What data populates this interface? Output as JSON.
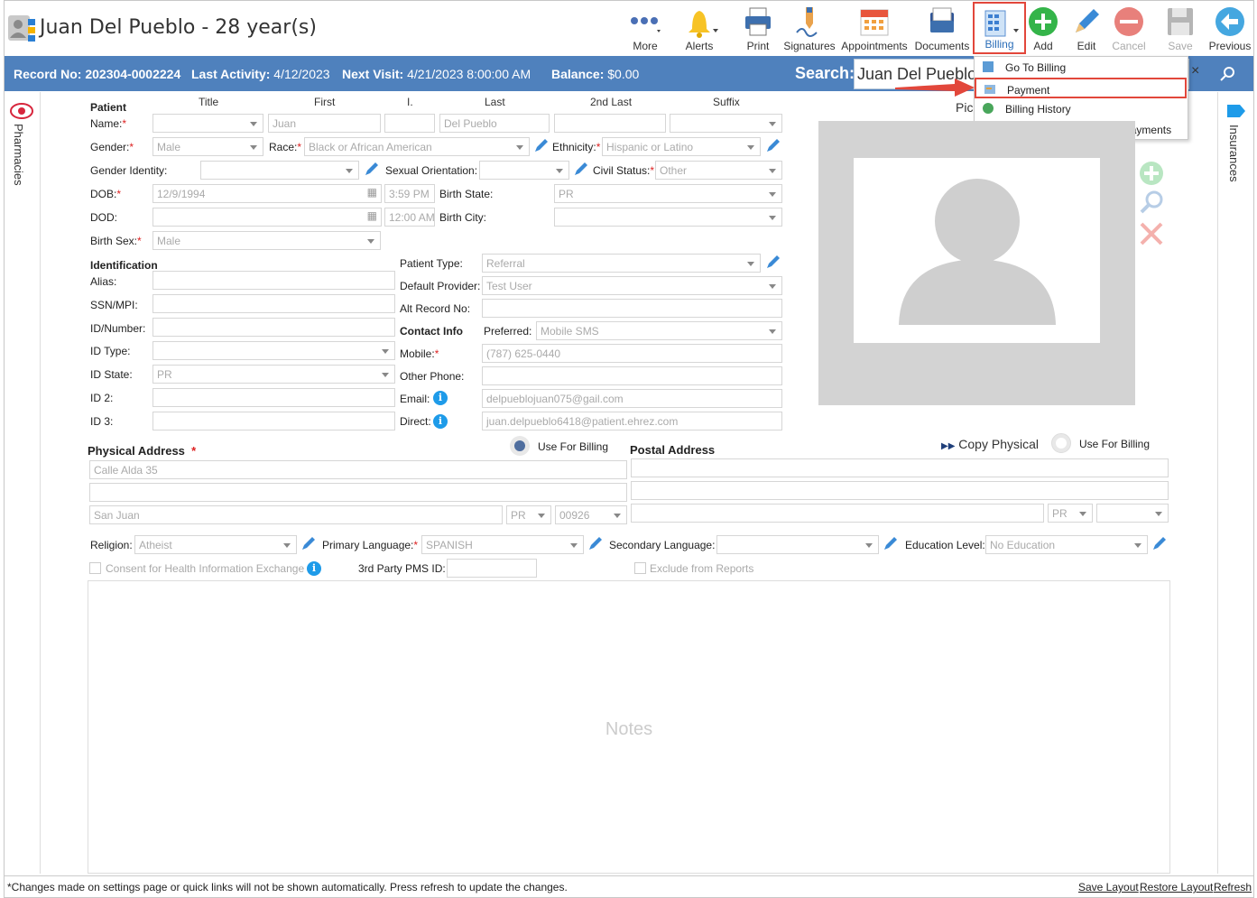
{
  "header": {
    "patient_title": "Juan Del Pueblo - 28 year(s)"
  },
  "toolbar": {
    "more": "More",
    "alerts": "Alerts",
    "print": "Print",
    "signatures": "Signatures",
    "appointments": "Appointments",
    "documents": "Documents",
    "billing": "Billing",
    "add": "Add",
    "edit": "Edit",
    "cancel": "Cancel",
    "save": "Save",
    "previous": "Previous"
  },
  "infobar": {
    "record_label": "Record No:",
    "record_value": "202304-0002224",
    "activity_label": "Last Activity:",
    "activity_value": "4/12/2023",
    "visit_label": "Next Visit:",
    "visit_value": "4/21/2023 8:00:00 AM",
    "balance_label": "Balance:",
    "balance_value": "$0.00",
    "search_label": "Search:",
    "search_value": "Juan Del Pueblo"
  },
  "billing_menu": [
    "Go To Billing",
    "Payment",
    "Billing History",
    "Daily Report - Purchase Payments"
  ],
  "side": {
    "left": "Pharmacies",
    "right": "Insurances"
  },
  "cols": {
    "title": "Title",
    "first": "First",
    "initial": "I.",
    "last": "Last",
    "second_last": "2nd Last",
    "suffix": "Suffix"
  },
  "labels": {
    "patient": "Patient",
    "name": "Name:",
    "gender": "Gender:",
    "race": "Race:",
    "ethnicity": "Ethnicity:",
    "gender_identity": "Gender Identity:",
    "sexual_orientation": "Sexual Orientation:",
    "civil_status": "Civil Status:",
    "dob": "DOB:",
    "birth_state": "Birth State:",
    "dod": "DOD:",
    "birth_city": "Birth City:",
    "birth_sex": "Birth Sex:",
    "identification": "Identification",
    "alias": "Alias:",
    "ssn": "SSN/MPI:",
    "id_number": "ID/Number:",
    "id_type": "ID Type:",
    "id_state": "ID State:",
    "id2": "ID 2:",
    "id3": "ID 3:",
    "patient_type": "Patient Type:",
    "default_provider": "Default Provider:",
    "alt_record": "Alt Record No:",
    "contact_info": "Contact Info",
    "preferred": "Preferred:",
    "mobile": "Mobile:",
    "other_phone": "Other Phone:",
    "email": "Email:",
    "direct": "Direct:",
    "physical_address": "Physical Address",
    "use_for_billing": "Use For Billing",
    "postal_address": "Postal Address",
    "copy_physical": "Copy Physical",
    "religion": "Religion:",
    "primary_language": "Primary Language:",
    "secondary_language": "Secondary Language:",
    "education_level": "Education Level:",
    "consent": "Consent for Health Information Exchange",
    "pms_id": "3rd Party PMS ID:",
    "exclude": "Exclude from Reports",
    "notes": "Notes",
    "picture": "Pic"
  },
  "values": {
    "first": "Juan",
    "last": "Del Pueblo",
    "gender": "Male",
    "race": "Black or African American",
    "ethnicity": "Hispanic or Latino",
    "civil_status": "Other",
    "dob": "12/9/1994",
    "dob_time": "3:59 PM",
    "birth_state": "PR",
    "dod_time": "12:00 AM",
    "birth_sex": "Male",
    "id_state": "PR",
    "patient_type": "Referral",
    "default_provider": "Test User",
    "preferred": "Mobile SMS",
    "mobile": "(787) 625-0440",
    "email": "delpueblojuan075@gail.com",
    "direct": "juan.delpueblo6418@patient.ehrez.com",
    "address1": "Calle Alda 35",
    "city": "San Juan",
    "state": "PR",
    "zip": "00926",
    "postal_state": "PR",
    "religion": "Atheist",
    "primary_language": "SPANISH",
    "education_level": "No Education"
  },
  "footer": {
    "note": "*Changes made on settings page or quick links will not be shown automatically. Press refresh to update the changes.",
    "save_layout": "Save Layout",
    "restore_layout": "Restore Layout",
    "refresh": "Refresh"
  },
  "colors": {
    "bar": "#4f81bd",
    "highlight": "#e2473b",
    "add": "#34b449",
    "cancel": "#e8807b",
    "info": "#1e9be9"
  }
}
